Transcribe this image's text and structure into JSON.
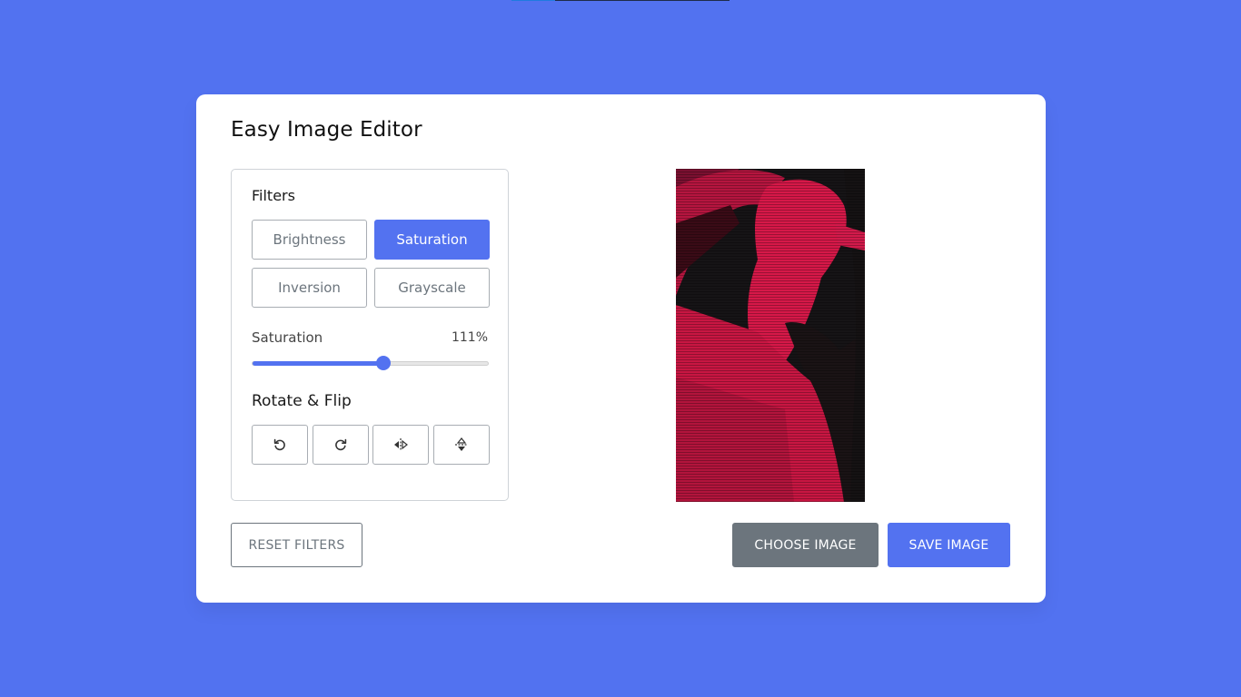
{
  "app": {
    "title": "Easy Image Editor"
  },
  "filters": {
    "heading": "Filters",
    "options": [
      {
        "label": "Brightness",
        "active": false
      },
      {
        "label": "Saturation",
        "active": true
      },
      {
        "label": "Inversion",
        "active": false
      },
      {
        "label": "Grayscale",
        "active": false
      }
    ]
  },
  "slider": {
    "label": "Saturation",
    "value_text": "111%",
    "value": 111,
    "max": 200
  },
  "rotate": {
    "heading": "Rotate & Flip",
    "buttons": [
      {
        "icon": "rotate-left-icon"
      },
      {
        "icon": "rotate-right-icon"
      },
      {
        "icon": "flip-horizontal-icon"
      },
      {
        "icon": "flip-vertical-icon"
      }
    ]
  },
  "actions": {
    "reset_label": "RESET FILTERS",
    "choose_label": "CHOOSE IMAGE",
    "save_label": "SAVE IMAGE"
  },
  "colors": {
    "background": "#5272f0",
    "accent": "#5372f0",
    "secondary": "#6c757d"
  }
}
